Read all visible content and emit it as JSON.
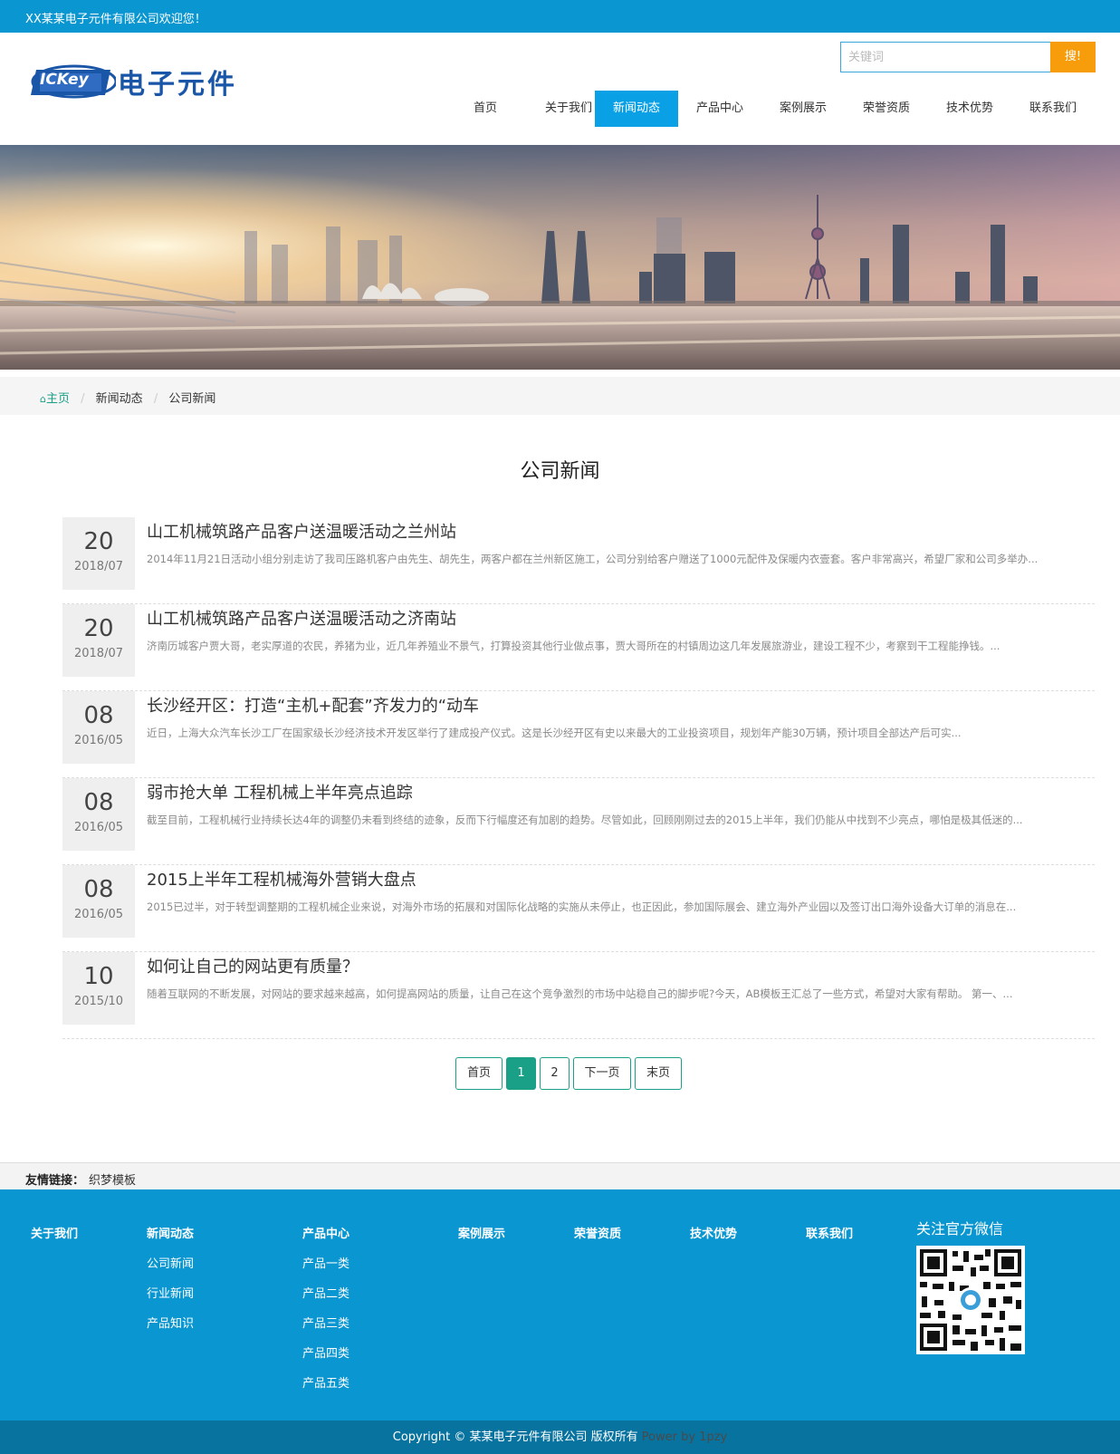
{
  "topbar": {
    "welcome": "XX某某电子元件有限公司欢迎您！"
  },
  "logo": {
    "badge_text": "ICKey",
    "text": "电子元件"
  },
  "search": {
    "placeholder": "关键词",
    "button": "搜!"
  },
  "nav": [
    {
      "label": "首页"
    },
    {
      "label": "关于我们"
    },
    {
      "label": "新闻动态",
      "active": true
    },
    {
      "label": "产品中心"
    },
    {
      "label": "案例展示"
    },
    {
      "label": "荣誉资质"
    },
    {
      "label": "技术优势"
    },
    {
      "label": "联系我们"
    }
  ],
  "breadcrumb": {
    "home": "主页",
    "level1": "新闻动态",
    "level2": "公司新闻"
  },
  "page_title": "公司新闻",
  "news": [
    {
      "day": "20",
      "ym": "2018/07",
      "title": "山工机械筑路产品客户送温暖活动之兰州站",
      "desc": "2014年11月21日活动小组分别走访了我司压路机客户由先生、胡先生，两客户都在兰州新区施工，公司分别给客户赠送了1000元配件及保暖内衣壹套。客户非常高兴，希望厂家和公司多举办..."
    },
    {
      "day": "20",
      "ym": "2018/07",
      "title": "山工机械筑路产品客户送温暖活动之济南站",
      "desc": "济南历城客户贾大哥，老实厚道的农民，养猪为业，近几年养殖业不景气，打算投资其他行业做点事，贾大哥所在的村镇周边这几年发展旅游业，建设工程不少，考察到干工程能挣钱。..."
    },
    {
      "day": "08",
      "ym": "2016/05",
      "title": "长沙经开区：打造“主机+配套”齐发力的“动车",
      "desc": "近日，上海大众汽车长沙工厂在国家级长沙经济技术开发区举行了建成投产仪式。这是长沙经开区有史以来最大的工业投资项目，规划年产能30万辆，预计项目全部达产后可实..."
    },
    {
      "day": "08",
      "ym": "2016/05",
      "title": "弱市抢大单 工程机械上半年亮点追踪",
      "desc": "截至目前，工程机械行业持续长达4年的调整仍未看到终结的迹象，反而下行幅度还有加剧的趋势。尽管如此，回顾刚刚过去的2015上半年，我们仍能从中找到不少亮点，哪怕是极其低迷的..."
    },
    {
      "day": "08",
      "ym": "2016/05",
      "title": "2015上半年工程机械海外营销大盘点",
      "desc": "2015已过半，对于转型调整期的工程机械企业来说，对海外市场的拓展和对国际化战略的实施从未停止，也正因此，参加国际展会、建立海外产业园以及签订出口海外设备大订单的消息在..."
    },
    {
      "day": "10",
      "ym": "2015/10",
      "title": "如何让自己的网站更有质量？",
      "desc": "随着互联网的不断发展，对网站的要求越来越高，如何提高网站的质量，让自己在这个竞争激烈的市场中站稳自己的脚步呢?今天，AB模板王汇总了一些方式，希望对大家有帮助。 第一、..."
    }
  ],
  "pager": {
    "first": "首页",
    "p1": "1",
    "p2": "2",
    "next": "下一页",
    "last": "末页",
    "current": 1
  },
  "links": {
    "label": "友情链接：",
    "items": [
      "织梦模板"
    ]
  },
  "footer": {
    "cols": [
      {
        "title": "关于我们",
        "items": []
      },
      {
        "title": "新闻动态",
        "items": [
          "公司新闻",
          "行业新闻",
          "产品知识"
        ]
      },
      {
        "title": "产品中心",
        "items": [
          "产品一类",
          "产品二类",
          "产品三类",
          "产品四类",
          "产品五类"
        ]
      },
      {
        "title": "案例展示",
        "items": []
      },
      {
        "title": "荣誉资质",
        "items": []
      },
      {
        "title": "技术优势",
        "items": []
      },
      {
        "title": "联系我们",
        "items": []
      }
    ],
    "wechat_title": "关注官方微信"
  },
  "copyright": {
    "text": "Copyright © 某某电子元件有限公司 版权所有",
    "power": "Power by 1pzy"
  },
  "colors": {
    "primary": "#0a96d1",
    "nav_active": "#0aa0e6",
    "search_button": "#f79c0b",
    "accent_green": "#1aa086",
    "copyright_bg": "#08739f"
  }
}
